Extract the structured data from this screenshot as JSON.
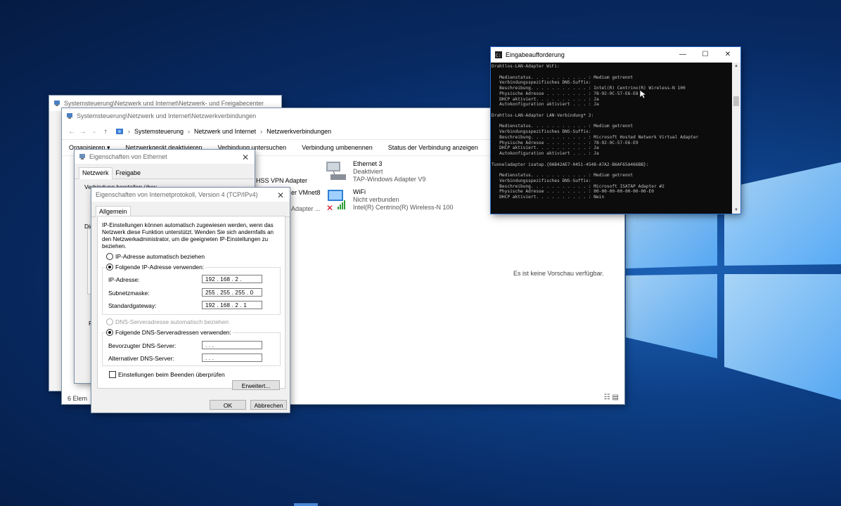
{
  "colors": {
    "accent": "#0078d7",
    "desktop": "#0d3f86",
    "cmd_bg": "#0c0c0c",
    "cmd_fg": "#c0c0c0"
  },
  "control_panel": {
    "title": "Systemsteuerung\\Netzwerk und Internet\\Netzwerk- und Freigabecenter"
  },
  "netconn": {
    "title": "Systemsteuerung\\Netzwerk und Internet\\Netzwerkverbindungen",
    "breadcrumb": [
      "Systemsteuerung",
      "Netzwerk und Internet",
      "Netzwerkverbindungen"
    ],
    "commands": [
      "Organisieren ▾",
      "Netzwerkgerät deaktivieren",
      "Verbindung untersuchen",
      "Verbindung umbenennen",
      "Status der Verbindung anzeigen",
      "»"
    ],
    "adapters": [
      {
        "name": "HSS VPN Adapter",
        "status": "",
        "device": ""
      },
      {
        "name": "er VMnet8",
        "status": "",
        "device": ""
      },
      {
        "name": "Adapter ...",
        "status": "",
        "device": ""
      },
      {
        "name": "Ethernet 3",
        "status": "Deaktiviert",
        "device": "TAP-Windows Adapter V9"
      },
      {
        "name": "WiFi",
        "status": "Nicht verbunden",
        "device": "Intel(R) Centrino(R) Wireless-N 100"
      }
    ],
    "preview_text": "Es ist keine Vorschau verfügbar.",
    "status_bar": "6 Elem"
  },
  "eth_props": {
    "title": "Eigenschaften von Ethernet",
    "tabs": [
      "Netzwerk",
      "Freigabe"
    ],
    "partial_label": "Verbindung herstellen über:",
    "partial_label2": "Die",
    "partial_label3": "R"
  },
  "ipv4": {
    "title": "Eigenschaften von Internetprotokoll, Version 4 (TCP/IPv4)",
    "tab": "Allgemein",
    "description": "IP-Einstellungen können automatisch zugewiesen werden, wenn das Netzwerk diese Funktion unterstützt. Wenden Sie sich andernfalls an den Netzwerkadministrator, um die geeigneten IP-Einstellungen zu beziehen.",
    "radio_ip_auto": "IP-Adresse automatisch beziehen",
    "radio_ip_manual": "Folgende IP-Adresse verwenden:",
    "label_ip": "IP-Adresse:",
    "label_mask": "Subnetzmaske:",
    "label_gateway": "Standardgateway:",
    "ip": "192 . 168 .  2  .",
    "mask": "255 . 255 . 255 .  0",
    "gateway": "192 . 168 .  2  .  1",
    "radio_dns_auto": "DNS-Serveradresse automatisch beziehen",
    "radio_dns_manual": "Folgende DNS-Serveradressen verwenden:",
    "label_dns1": "Bevorzugter DNS-Server:",
    "label_dns2": "Alternativer DNS-Server:",
    "dns1": "     .     .     .",
    "dns2": "     .     .     .",
    "checkbox_validate": "Einstellungen beim Beenden überprüfen",
    "btn_advanced": "Erweitert...",
    "btn_ok": "OK",
    "btn_cancel": "Abbrechen"
  },
  "cmd": {
    "title": "Eingabeaufforderung",
    "text": "Drahtlos-LAN-Adapter WiFi:\n\n   Medienstatus. . . . . . . . . . . : Medium getrennt\n   Verbindungsspezifisches DNS-Suffix:\n   Beschreibung. . . . . . . . . . . : Intel(R) Centrino(R) Wireless-N 100\n   Physische Adresse . . . . . . . . : 78-92-9C-57-E6-E8\n   DHCP aktiviert. . . . . . . . . . : Ja\n   Autokonfiguration aktiviert . . . : Ja\n\nDrahtlos-LAN-Adapter LAN-Verbindung* 2:\n\n   Medienstatus. . . . . . . . . . . : Medium getrennt\n   Verbindungsspezifisches DNS-Suffix:\n   Beschreibung. . . . . . . . . . . : Microsoft Hosted Network Virtual Adapter\n   Physische Adresse . . . . . . . . : 78-92-9C-57-E6-E9\n   DHCP aktiviert. . . . . . . . . . : Ja\n   Autokonfiguration aktiviert . . . : Ja\n\nTunneladapter isatap.{0AB42AE7-0451-4548-A7A2-B6AF65A466BB}:\n\n   Medienstatus. . . . . . . . . . . : Medium getrennt\n   Verbindungsspezifisches DNS-Suffix:\n   Beschreibung. . . . . . . . . . . : Microsoft ISATAP Adapter #2\n   Physische Adresse . . . . . . . . : 00-00-00-00-00-00-00-E0\n   DHCP aktiviert. . . . . . . . . . : Nein"
  }
}
